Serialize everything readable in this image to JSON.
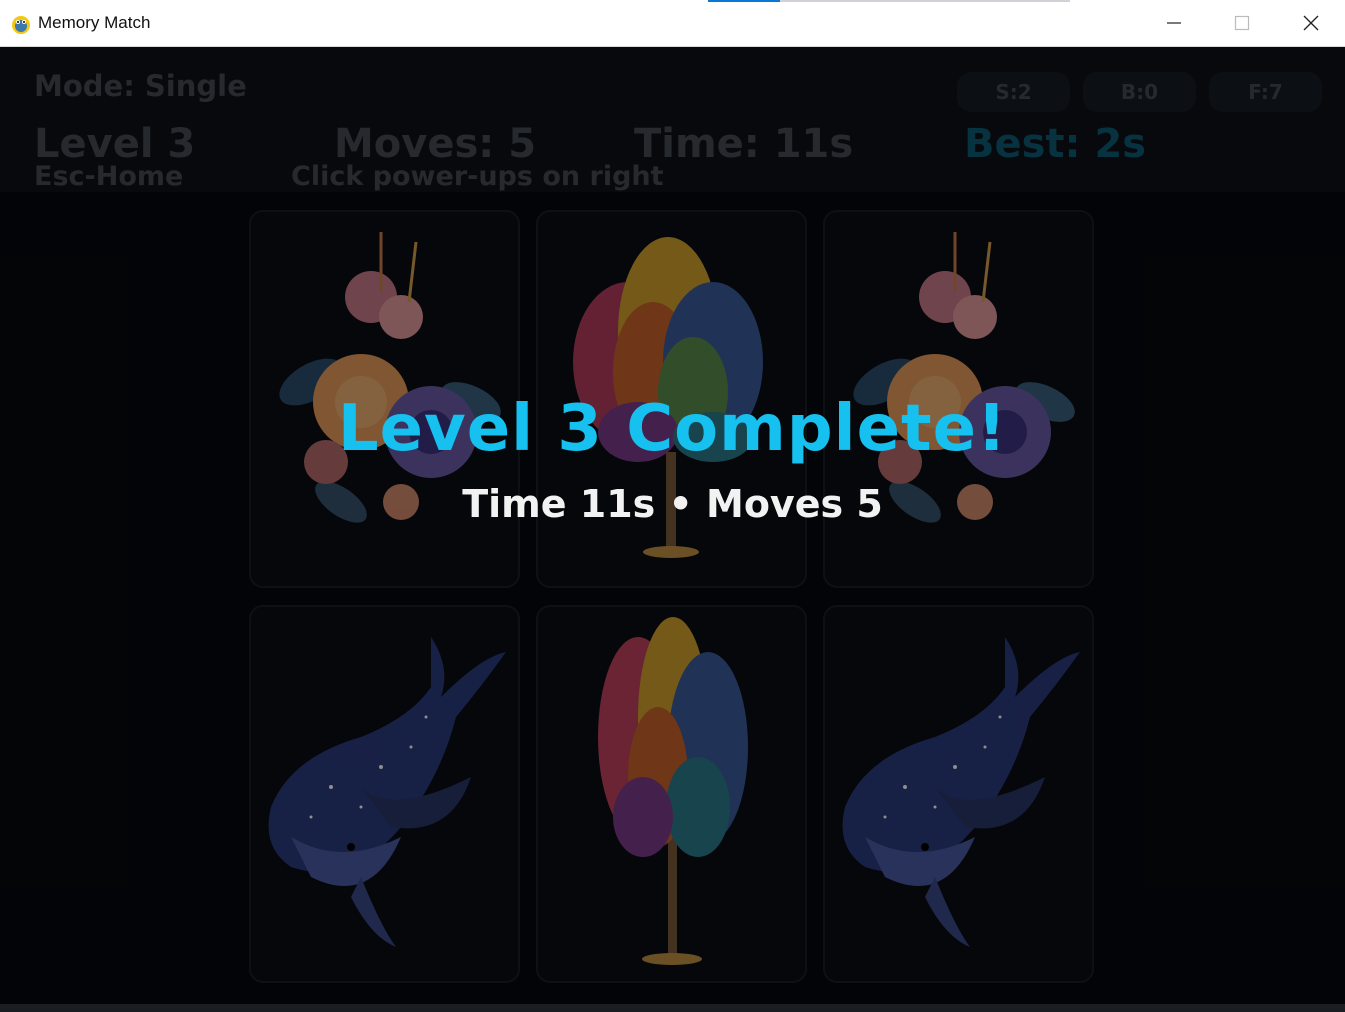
{
  "window": {
    "title": "Memory Match"
  },
  "hud": {
    "mode": "Mode: Single",
    "level": "Level 3",
    "esc_hint": "Esc-Home",
    "moves": "Moves: 5",
    "powerup_hint": "Click power-ups on right",
    "time": "Time: 11s",
    "best": "Best: 2s"
  },
  "powerups": [
    {
      "label": "S:2"
    },
    {
      "label": "B:0"
    },
    {
      "label": "F:7"
    }
  ],
  "cards": [
    {
      "image": "flower-bouquet-icon"
    },
    {
      "image": "rainbow-tree-icon"
    },
    {
      "image": "flower-bouquet-icon"
    },
    {
      "image": "galaxy-whale-icon"
    },
    {
      "image": "rainbow-tree-icon"
    },
    {
      "image": "galaxy-whale-icon"
    }
  ],
  "overlay": {
    "title": "Level 3 Complete!",
    "summary": "Time 11s • Moves 5"
  },
  "colors": {
    "accent": "#16c0ef",
    "best": "#0b4d63",
    "background": "#04070b"
  }
}
